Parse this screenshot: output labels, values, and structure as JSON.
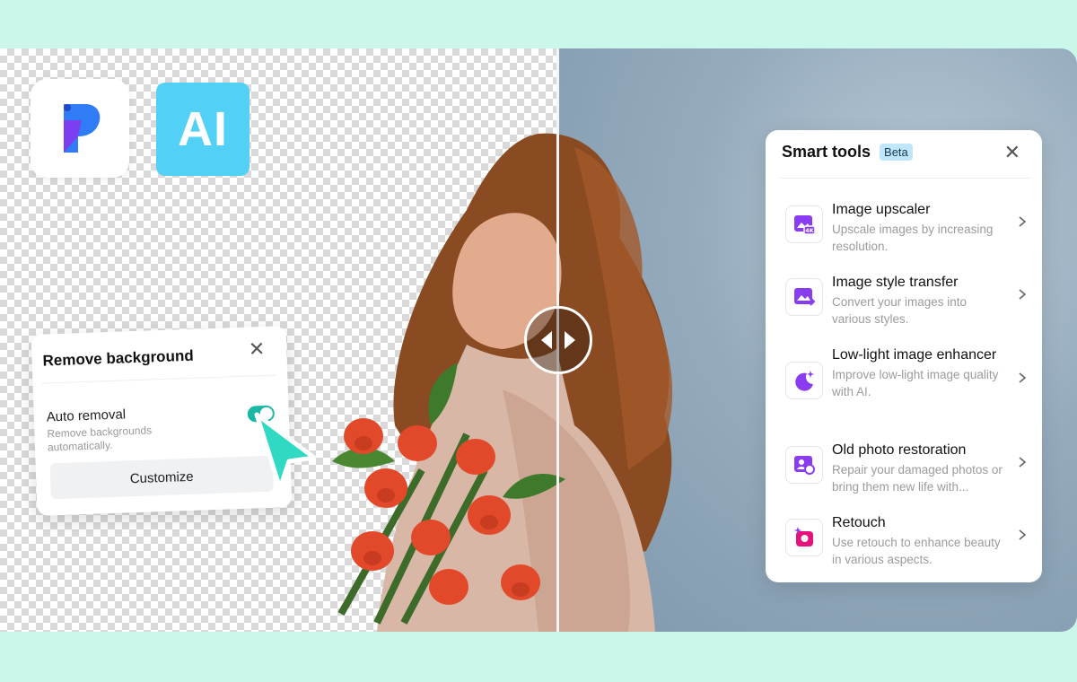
{
  "colors": {
    "page_bg": "#cbf6ea",
    "ai_tile": "#53d0f6",
    "toggle_on": "#1bb9a4",
    "cursor": "#2fd9c2",
    "tool_icon": "#8a3df0",
    "beta_bg": "#bfe6fb"
  },
  "brand": {
    "logo_icon": "pixcut-logo-icon",
    "ai_badge": "AI"
  },
  "remove_bg": {
    "title": "Remove background",
    "auto_label": "Auto removal",
    "auto_desc": "Remove backgrounds automatically.",
    "auto_on": true,
    "customize_label": "Customize"
  },
  "smart_tools": {
    "title": "Smart tools",
    "badge": "Beta",
    "items": [
      {
        "name": "Image upscaler",
        "desc": "Upscale images by increasing resolution.",
        "icon": "upscale-4k-icon"
      },
      {
        "name": "Image style transfer",
        "desc": "Convert your images into various styles.",
        "icon": "style-transfer-icon"
      },
      {
        "name": "Low-light image enhancer",
        "desc": "Improve low-light image quality with AI.",
        "icon": "moon-sparkle-icon"
      },
      {
        "name": "Old photo restoration",
        "desc": "Repair your damaged photos or bring them new life with...",
        "icon": "photo-restore-icon"
      },
      {
        "name": "Retouch",
        "desc": "Use retouch to enhance beauty in various aspects.",
        "icon": "retouch-icon"
      }
    ]
  }
}
